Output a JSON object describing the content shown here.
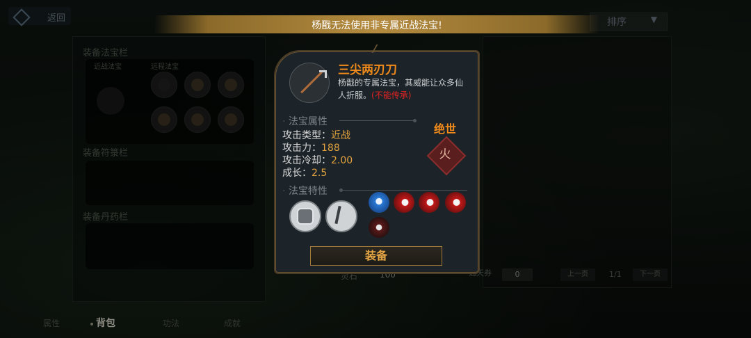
{
  "header": {
    "back_label": "返回",
    "sort_label": "排序"
  },
  "warning": "杨戬无法使用非专属近战法宝!",
  "left_panel": {
    "treasure_section": "装备法宝栏",
    "melee_label": "近战法宝",
    "ranged_label": "远程法宝",
    "talisman_section": "装备符箓栏",
    "pill_section": "装备丹药栏"
  },
  "item": {
    "name": "三尖两刃刀",
    "description": "杨戬的专属法宝，其威能让众多仙人折服。",
    "note": "(不能传承)",
    "attributes_title": "法宝属性",
    "attack_type_label": "攻击类型：",
    "attack_type_value": "近战",
    "attack_label": "攻击力：",
    "attack_value": "188",
    "cooldown_label": "攻击冷却：",
    "cooldown_value": "2.00",
    "growth_label": "成长：",
    "growth_value": "2.5",
    "rarity": "绝世",
    "rarity_glyph": "火",
    "traits_title": "法宝特性",
    "equip_label": "装备"
  },
  "footer": {
    "lingshi_label": "灵石",
    "lingshi_value": "100",
    "ticket_label": "通天券",
    "ticket_value": "0",
    "prev_label": "上一页",
    "page": "1/1",
    "next_label": "下一页"
  },
  "tabs": [
    "属性",
    "背包",
    "功法",
    "成就"
  ],
  "colors": {
    "accent": "#f08a1a",
    "warning_red": "#e02222",
    "gold": "#e4a545"
  }
}
